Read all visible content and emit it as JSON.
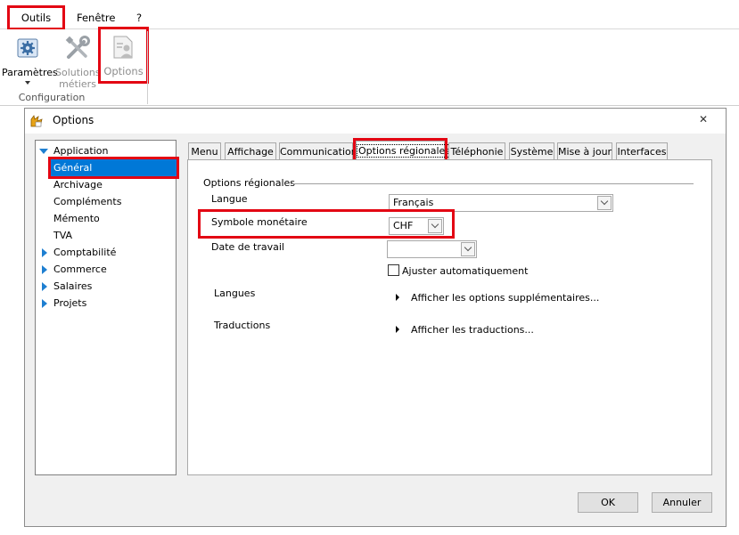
{
  "menubar": {
    "outils": "Outils",
    "fenetre": "Fenêtre",
    "help": "?"
  },
  "ribbon": {
    "parametres": "Paramètres",
    "solutions_line1": "Solutions",
    "solutions_line2": "métiers",
    "options": "Options",
    "group_label": "Configuration"
  },
  "dialog": {
    "title": "Options",
    "close_glyph": "✕",
    "tree": [
      {
        "label": "Application"
      },
      {
        "label": "Général"
      },
      {
        "label": "Archivage"
      },
      {
        "label": "Compléments"
      },
      {
        "label": "Mémento"
      },
      {
        "label": "TVA"
      },
      {
        "label": "Comptabilité"
      },
      {
        "label": "Commerce"
      },
      {
        "label": "Salaires"
      },
      {
        "label": "Projets"
      }
    ],
    "tabs": [
      "Menu",
      "Affichage",
      "Communication",
      "Options régionales",
      "Téléphonie",
      "Système",
      "Mise à jour",
      "Interfaces"
    ],
    "section_title": "Options régionales",
    "langue_label": "Langue",
    "langue_value": "Français",
    "symbole_label": "Symbole monétaire",
    "symbole_value": "CHF",
    "date_label": "Date de travail",
    "date_value": "",
    "ajuster_label": "Ajuster automatiquement",
    "ajuster_checked": false,
    "langues_label": "Langues",
    "langues_link": "Afficher les options supplémentaires...",
    "traductions_label": "Traductions",
    "traductions_link": "Afficher les traductions...",
    "ok": "OK",
    "annuler": "Annuler"
  },
  "colors": {
    "highlight": "#e30613",
    "selection": "#0078d7",
    "tree_arrow": "#1e7fd1"
  }
}
